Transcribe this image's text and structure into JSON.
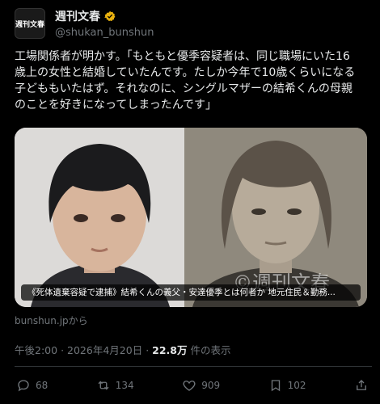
{
  "account": {
    "avatar_text": "週刊文春",
    "display_name": "週刊文春",
    "handle": "@shukan_bunshun",
    "verified_color": "#e8b10f"
  },
  "tweet": {
    "lines": [
      "工場関係者が明かす。「もともと優季容疑者は、同じ職場にいた16",
      "歳上の女性と結婚していたんです。たしか今年で10歳くらいになる",
      "子どももいたはず。それなのに、シングルマザーの結希くんの母親",
      "のことを好きになってしまったんです」"
    ]
  },
  "media": {
    "caption": "《死体遺棄容疑で逮捕》結希くんの義父・安達優季とは何者か 地元住民＆勤務...",
    "watermark": "©週刊文春"
  },
  "link_source": "bunshun.jpから",
  "meta": {
    "time": "午後2:00",
    "sep": "·",
    "date": "2026年4月20日",
    "views_count": "22.8万",
    "views_label": "件の表示"
  },
  "actions": {
    "replies": "68",
    "reposts": "134",
    "likes": "909",
    "bookmarks": "102"
  },
  "colors": {
    "background": "#000000",
    "text": "#e7e9ea",
    "muted": "#71767b"
  }
}
